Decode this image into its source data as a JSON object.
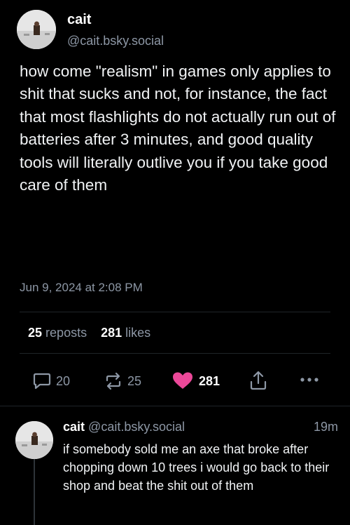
{
  "post": {
    "author": {
      "display_name": "cait",
      "handle": "@cait.bsky.social"
    },
    "text": "how come \"realism\" in games only applies to shit that sucks and not, for instance, the fact that most flashlights do not actually run out of batteries after 3 minutes, and good quality tools will literally outlive you if you take good care of them",
    "date": "Jun 9, 2024 at 2:08 PM",
    "stats": {
      "reposts_count": "25",
      "reposts_label": "reposts",
      "likes_count": "281",
      "likes_label": "likes"
    },
    "actions": {
      "reply_count": "20",
      "repost_count": "25",
      "like_count": "281"
    }
  },
  "reply": {
    "author": {
      "display_name": "cait",
      "handle": "@cait.bsky.social"
    },
    "time": "19m",
    "text": "if somebody sold me an axe that broke after chopping down 10 trees i would go back to their shop and beat the shit out of them"
  },
  "colors": {
    "background": "#000000",
    "muted": "#8d97a5",
    "like": "#ec4899"
  },
  "icons": [
    "reply-icon",
    "repost-icon",
    "heart-icon",
    "share-icon",
    "more-icon"
  ]
}
